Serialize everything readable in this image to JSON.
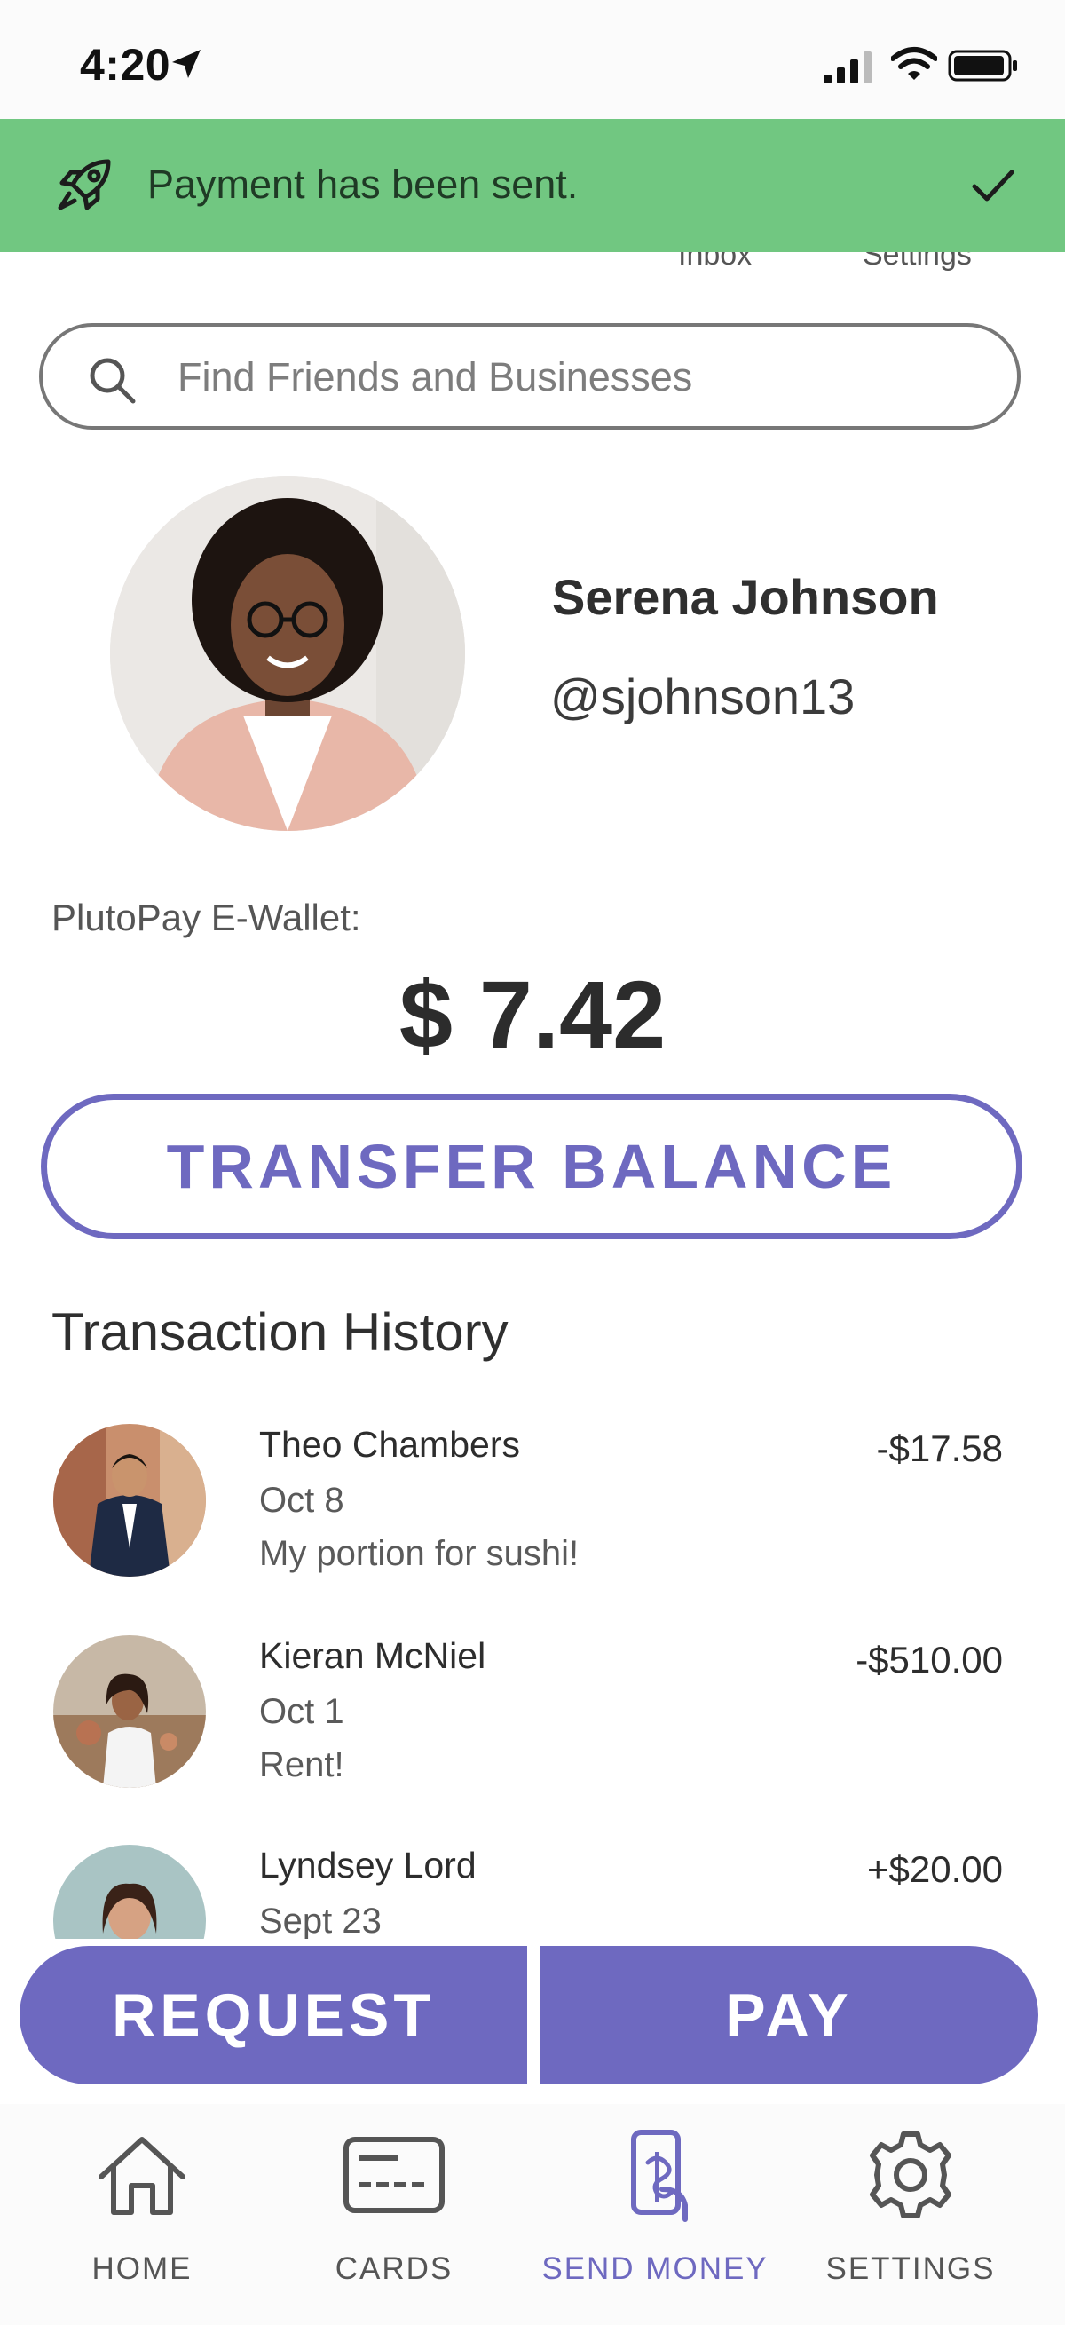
{
  "status_bar": {
    "time": "4:20"
  },
  "toast": {
    "message": "Payment has been sent."
  },
  "header_peek": {
    "inbox": "Inbox",
    "settings": "Settings"
  },
  "search": {
    "placeholder": "Find Friends and Businesses"
  },
  "profile": {
    "name": "Serena Johnson",
    "handle": "@sjohnson13"
  },
  "wallet": {
    "label": "PlutoPay E-Wallet:",
    "amount": "$ 7.42"
  },
  "transfer_button": "TRANSFER BALANCE",
  "history": {
    "title": "Transaction History",
    "items": [
      {
        "name": "Theo Chambers",
        "date": "Oct 8",
        "note": "My portion for sushi!",
        "amount": "-$17.58"
      },
      {
        "name": "Kieran McNiel",
        "date": "Oct 1",
        "note": "Rent!",
        "amount": "-$510.00"
      },
      {
        "name": "Lyndsey Lord",
        "date": "Sept 23",
        "note": "",
        "amount": "+$20.00"
      }
    ]
  },
  "actions": {
    "request": "REQUEST",
    "pay": "PAY"
  },
  "tabbar": {
    "items": [
      {
        "label": "HOME",
        "icon": "home-icon"
      },
      {
        "label": "CARDS",
        "icon": "card-icon"
      },
      {
        "label": "SEND MONEY",
        "icon": "send-money-icon",
        "active": true
      },
      {
        "label": "SETTINGS",
        "icon": "gear-icon"
      }
    ]
  },
  "colors": {
    "accent": "#6e69c0",
    "toast": "#71c781"
  }
}
